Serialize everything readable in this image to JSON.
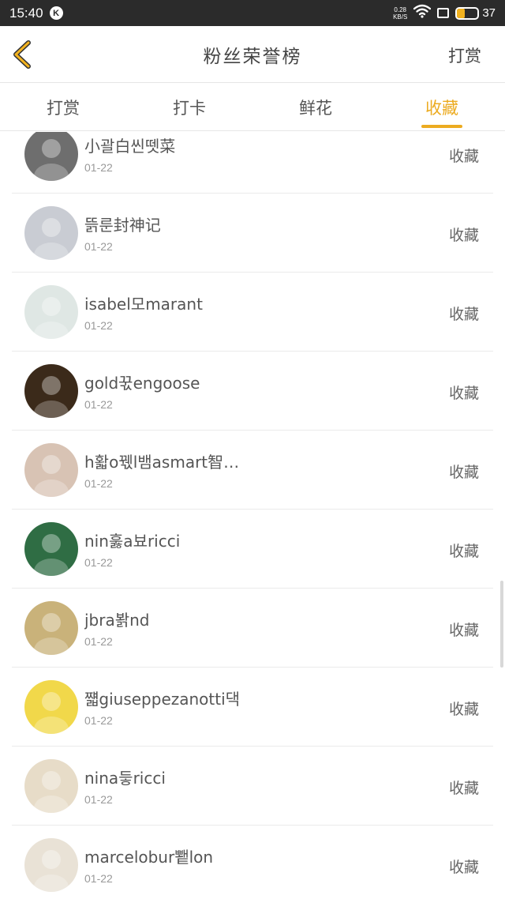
{
  "status": {
    "time": "15:40",
    "badge": "K",
    "net_speed_value": "0.28",
    "net_speed_unit": "KB/S",
    "battery_level": "37"
  },
  "nav": {
    "title": "粉丝荣誉榜",
    "right_action": "打赏"
  },
  "tabs": [
    {
      "label": "打赏",
      "active": false
    },
    {
      "label": "打卡",
      "active": false
    },
    {
      "label": "鲜花",
      "active": false
    },
    {
      "label": "收藏",
      "active": true
    }
  ],
  "fans": [
    {
      "name": "小괄白씬뗏菜",
      "date": "01-22",
      "action": "收藏",
      "avatar_color": "#6e6e6e"
    },
    {
      "name": "뜱룬封神记",
      "date": "01-22",
      "action": "收藏",
      "avatar_color": "#c9ccd3"
    },
    {
      "name": "isabel모marant",
      "date": "01-22",
      "action": "收藏",
      "avatar_color": "#dfe7e4"
    },
    {
      "name": "gold꾻engoose",
      "date": "01-22",
      "action": "收藏",
      "avatar_color": "#3b2a1a"
    },
    {
      "name": "h홟o꿳l뱀asmart智…",
      "date": "01-22",
      "action": "收藏",
      "avatar_color": "#d8c3b4"
    },
    {
      "name": "nin훓a뵤ricci",
      "date": "01-22",
      "action": "收藏",
      "avatar_color": "#2f6d44"
    },
    {
      "name": "jbra봙nd",
      "date": "01-22",
      "action": "收藏",
      "avatar_color": "#c9b27a"
    },
    {
      "name": "쨻giuseppezanotti댁",
      "date": "01-22",
      "action": "收藏",
      "avatar_color": "#f1d84a"
    },
    {
      "name": "nina듷ricci",
      "date": "01-22",
      "action": "收藏",
      "avatar_color": "#e7dcc8"
    },
    {
      "name": "marcelobur뾑lon",
      "date": "01-22",
      "action": "收藏",
      "avatar_color": "#e9e2d6"
    }
  ],
  "theme": {
    "accent": "#ecab20",
    "status_bar": "#2b2b2b"
  }
}
